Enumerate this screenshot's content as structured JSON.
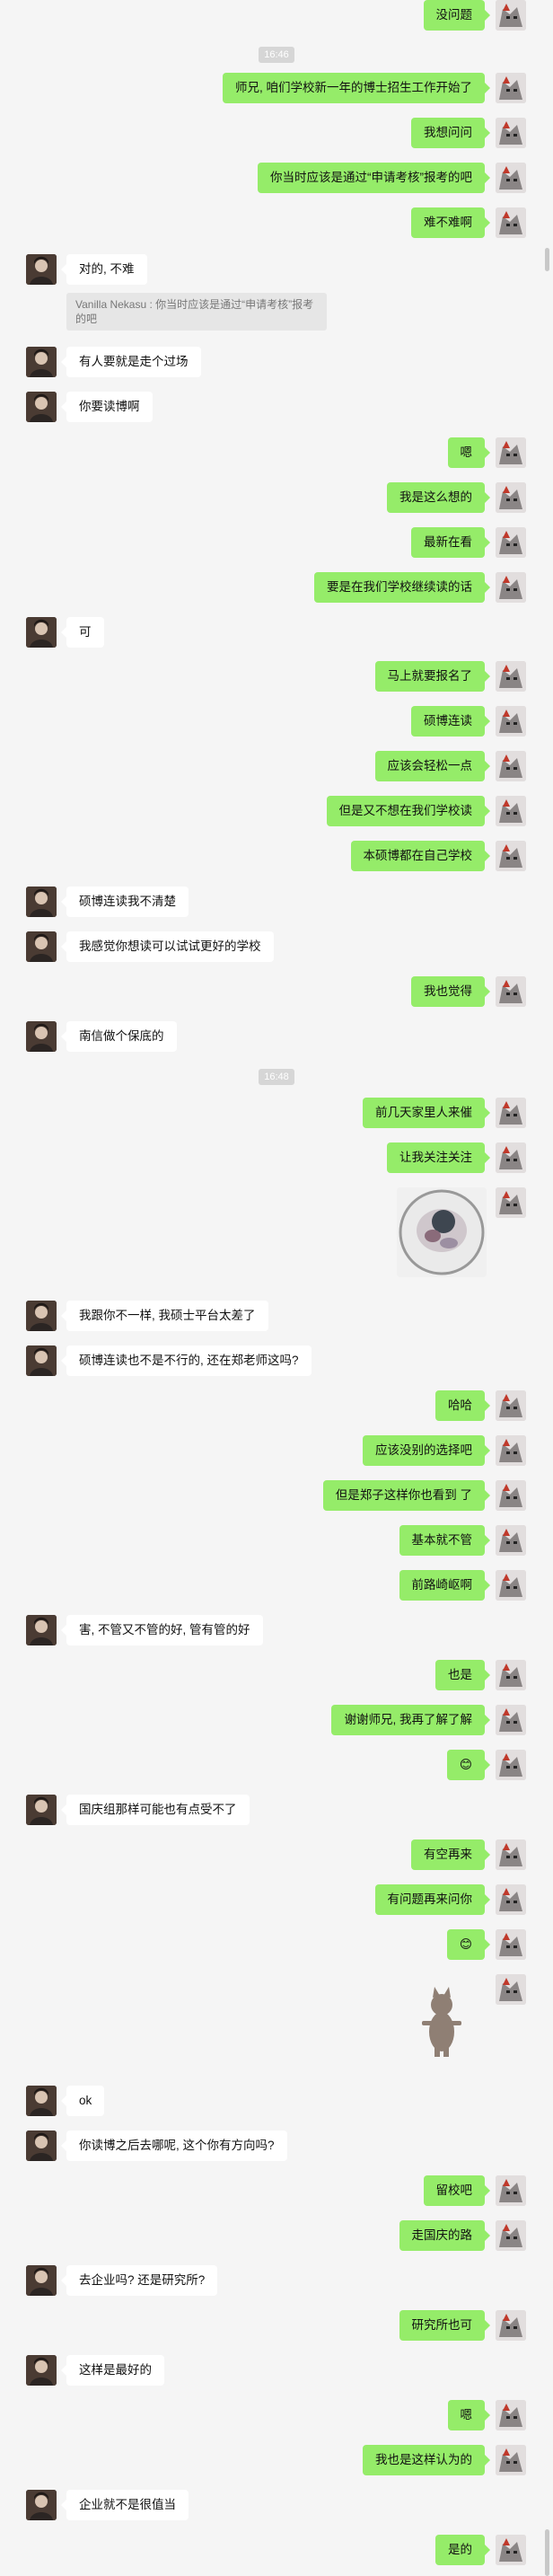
{
  "timestamps": [
    "16:46",
    "16:48"
  ],
  "messages": [
    {
      "side": "me",
      "text": "没问题"
    },
    {
      "side": "me",
      "text": "师兄, 咱们学校新一年的博士招生工作开始了"
    },
    {
      "side": "me",
      "text": "我想问问"
    },
    {
      "side": "me",
      "text": "你当时应该是通过“申请考核”报考的吧"
    },
    {
      "side": "me",
      "text": "难不难啊"
    },
    {
      "side": "other",
      "text": "对的, 不难"
    },
    {
      "side": "quote",
      "text": "Vanilla Nekasu : 你当时应该是通过“申请考核”报考的吧"
    },
    {
      "side": "other",
      "text": "有人要就是走个过场"
    },
    {
      "side": "other",
      "text": "你要读博啊"
    },
    {
      "side": "me",
      "text": "嗯"
    },
    {
      "side": "me",
      "text": "我是这么想的"
    },
    {
      "side": "me",
      "text": "最新在看"
    },
    {
      "side": "me",
      "text": "要是在我们学校继续读的话"
    },
    {
      "side": "other",
      "text": "可"
    },
    {
      "side": "me",
      "text": "马上就要报名了"
    },
    {
      "side": "me",
      "text": "硕博连读"
    },
    {
      "side": "me",
      "text": "应该会轻松一点"
    },
    {
      "side": "me",
      "text": "但是又不想在我们学校读"
    },
    {
      "side": "me",
      "text": "本硕博都在自己学校"
    },
    {
      "side": "other",
      "text": "硕博连读我不清楚"
    },
    {
      "side": "other",
      "text": "我感觉你想读可以试试更好的学校"
    },
    {
      "side": "me",
      "text": "我也觉得"
    },
    {
      "side": "other",
      "text": "南信做个保底的"
    },
    {
      "side": "me",
      "text": "前几天家里人来催"
    },
    {
      "side": "me",
      "text": "让我关注关注"
    },
    {
      "side": "other",
      "text": "我跟你不一样, 我硕士平台太差了"
    },
    {
      "side": "other",
      "text": "硕博连读也不是不行的, 还在郑老师这吗?"
    },
    {
      "side": "me",
      "text": "哈哈"
    },
    {
      "side": "me",
      "text": "应该没别的选择吧"
    },
    {
      "side": "me",
      "text": "但是郑子这样你也看到 了"
    },
    {
      "side": "me",
      "text": "基本就不管"
    },
    {
      "side": "me",
      "text": "前路崎岖啊"
    },
    {
      "side": "other",
      "text": "害, 不管又不管的好, 管有管的好"
    },
    {
      "side": "me",
      "text": "也是"
    },
    {
      "side": "me",
      "text": "谢谢师兄, 我再了解了解"
    },
    {
      "side": "me",
      "text": "😊"
    },
    {
      "side": "other",
      "text": "国庆组那样可能也有点受不了"
    },
    {
      "side": "me",
      "text": "有空再来"
    },
    {
      "side": "me",
      "text": "有问题再来问你"
    },
    {
      "side": "me",
      "text": "😊"
    },
    {
      "side": "other",
      "text": "ok"
    },
    {
      "side": "other",
      "text": "你读博之后去哪呢, 这个你有方向吗?"
    },
    {
      "side": "me",
      "text": "留校吧"
    },
    {
      "side": "me",
      "text": "走国庆的路"
    },
    {
      "side": "other",
      "text": "去企业吗? 还是研究所?"
    },
    {
      "side": "me",
      "text": "研究所也可"
    },
    {
      "side": "other",
      "text": "这样是最好的"
    },
    {
      "side": "me",
      "text": "嗯"
    },
    {
      "side": "me",
      "text": "我也是这样认为的"
    },
    {
      "side": "other",
      "text": "企业就不是很值当"
    },
    {
      "side": "me",
      "text": "是的"
    }
  ],
  "colors": {
    "my_bubble": "#95ec69",
    "other_bubble": "#ffffff",
    "background": "#f5f5f5"
  }
}
